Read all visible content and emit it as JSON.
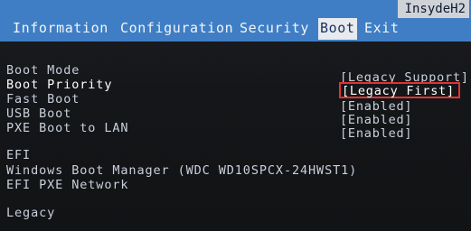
{
  "vendor": "InsydeH2",
  "menu": {
    "tabs": [
      {
        "label": "Information",
        "active": false
      },
      {
        "label": "Configuration",
        "active": false
      },
      {
        "label": "Security",
        "active": false
      },
      {
        "label": "Boot",
        "active": true
      },
      {
        "label": "Exit",
        "active": false
      }
    ]
  },
  "settings": [
    {
      "label": "Boot Mode",
      "value": "[Legacy Support]"
    },
    {
      "label": "Boot Priority",
      "value": "[Legacy First]",
      "selected": true
    },
    {
      "label": "Fast Boot",
      "value": "[Enabled]"
    },
    {
      "label": "USB Boot",
      "value": "[Enabled]"
    },
    {
      "label": "PXE Boot to LAN",
      "value": "[Enabled]"
    }
  ],
  "efi": {
    "heading": "EFI",
    "items": [
      "Windows Boot Manager (WDC WD10SPCX-24HWST1)",
      "EFI PXE Network"
    ]
  },
  "legacy": {
    "heading": "Legacy"
  },
  "colors": {
    "header_bg": "#3f7ec4",
    "active_tab_bg": "#e7eaee",
    "screen_bg": "#151619",
    "text": "#c8d0dc",
    "highlight_box": "#e2332f"
  }
}
